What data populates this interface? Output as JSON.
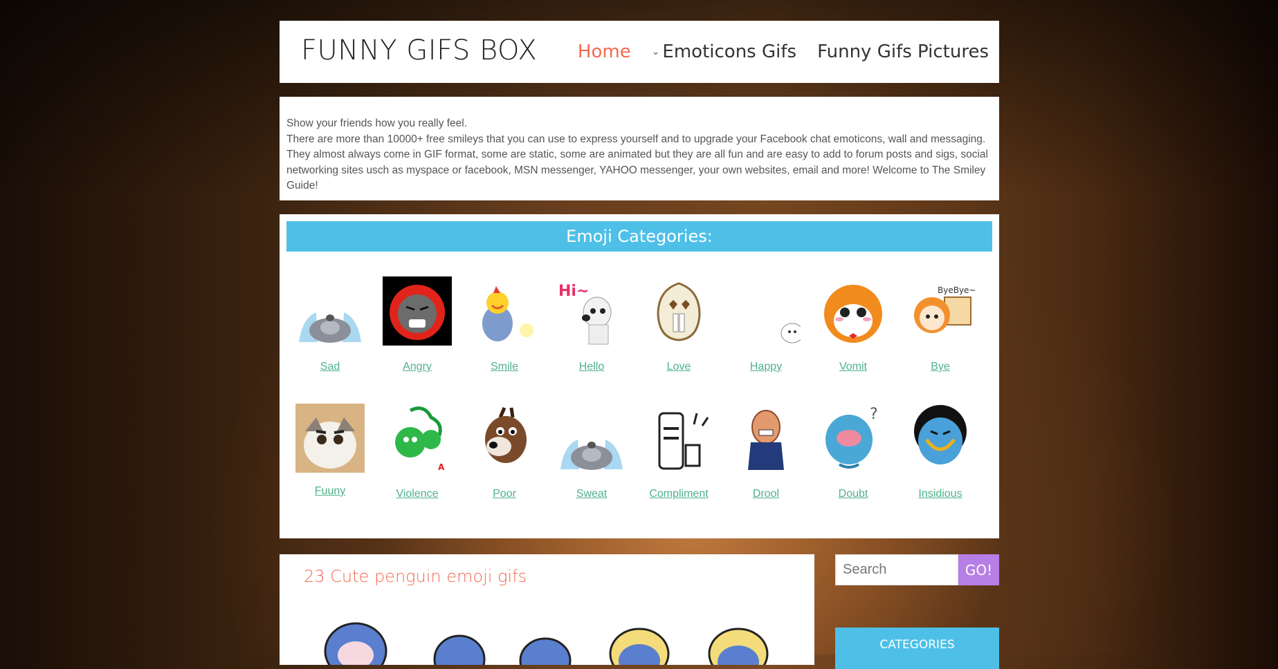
{
  "site": {
    "title": "FUNNY GIFS BOX",
    "nav": [
      {
        "label": "Home"
      },
      {
        "label": "Emoticons Gifs"
      },
      {
        "label": "Funny Gifs Pictures"
      }
    ]
  },
  "intro": {
    "line1": "Show your friends how you really feel.",
    "line2": "There are more than 10000+ free smileys that you can use to express yourself and to upgrade your Facebook chat emoticons, wall and messaging. They almost always come in GIF format, some are static, some are animated but they are all fun and are easy to add to forum posts and sigs, social networking sites usch as myspace or facebook, MSN messenger, YAHOO messenger, your own websites, email and more! Welcome to The Smiley Guide!"
  },
  "categories": {
    "heading": "Emoji Categories:",
    "items": [
      {
        "label": "Sad"
      },
      {
        "label": "Angry"
      },
      {
        "label": "Smile"
      },
      {
        "label": "Hello"
      },
      {
        "label": "Love"
      },
      {
        "label": "Happy"
      },
      {
        "label": "Vomit"
      },
      {
        "label": "Bye"
      },
      {
        "label": "Fuuny"
      },
      {
        "label": "Violence"
      },
      {
        "label": "Poor"
      },
      {
        "label": "Sweat"
      },
      {
        "label": "Compliment"
      },
      {
        "label": "Drool"
      },
      {
        "label": "Doubt"
      },
      {
        "label": "Insidious"
      }
    ]
  },
  "post": {
    "title": "23 Cute penguin emoji gifs"
  },
  "sidebar": {
    "search_placeholder": "Search",
    "search_button": "GO!",
    "categories_heading": "CATEGORIES"
  },
  "colors": {
    "accent": "#f26a50",
    "bar": "#4ec0e8",
    "link": "#4fb08a",
    "button": "#b77ee6"
  }
}
